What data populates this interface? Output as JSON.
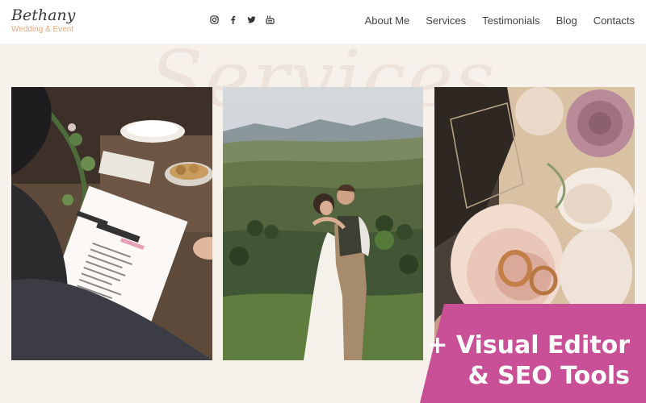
{
  "brand": {
    "name": "Bethany",
    "tagline": "Wedding & Event",
    "tagline_color": "#e8a87c"
  },
  "social": [
    {
      "icon": "instagram-icon"
    },
    {
      "icon": "facebook-icon"
    },
    {
      "icon": "twitter-icon"
    },
    {
      "icon": "youtube-icon"
    }
  ],
  "nav": {
    "items": [
      "About Me",
      "Services",
      "Testimonials",
      "Blog",
      "Contacts"
    ]
  },
  "section": {
    "background_title": "Services"
  },
  "gallery": [
    {
      "description_icon": "wedding-planner-photo"
    },
    {
      "description_icon": "couple-photo"
    },
    {
      "description_icon": "rings-and-roses-photo"
    }
  ],
  "promo": {
    "line1": "+ Visual Editor",
    "line2": "& SEO Tools",
    "color": "#c94f96"
  }
}
